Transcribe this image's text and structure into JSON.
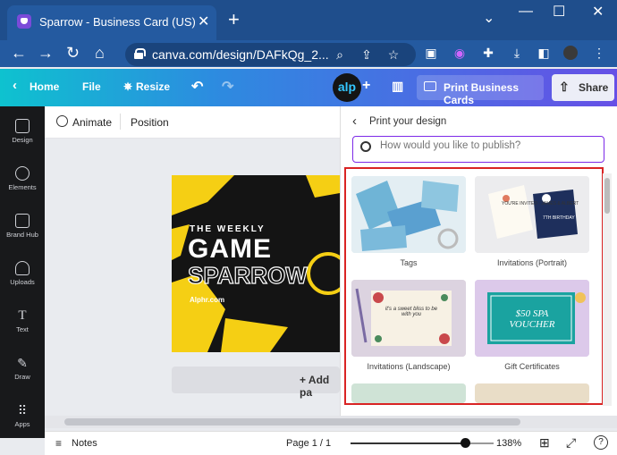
{
  "browser": {
    "tab_title": "Sparrow - Business Card (US)",
    "url": "canva.com/design/DAFkQg_2..."
  },
  "canva_header": {
    "home": "Home",
    "file": "File",
    "resize": "Resize",
    "avatar": "alp",
    "print": "Print Business Cards",
    "share": "Share"
  },
  "sidebar": {
    "items": [
      {
        "label": "Design"
      },
      {
        "label": "Elements"
      },
      {
        "label": "Brand Hub"
      },
      {
        "label": "Uploads"
      },
      {
        "label": "Text"
      },
      {
        "label": "Draw"
      },
      {
        "label": "Apps"
      }
    ]
  },
  "toolbar": {
    "animate": "Animate",
    "position": "Position"
  },
  "card": {
    "line1": "THE WEEKLY",
    "line2": "GAME",
    "line3": "SPARROW",
    "line4": "Alphr.com"
  },
  "add_page": "+ Add pa",
  "panel": {
    "title": "Print your design",
    "search_placeholder": "How would you like to publish?",
    "items": [
      {
        "label": "Tags"
      },
      {
        "label": "Invitations (Portrait)"
      },
      {
        "label": "Invitations (Landscape)"
      },
      {
        "label": "Gift Certificates"
      }
    ],
    "thumb_text": {
      "inv_portrait_1": "YOU'RE INVITED · JAMES & ALBERT",
      "inv_portrait_2": "7TH BIRTHDAY",
      "inv_landscape": "it's a sweet bliss to be with you",
      "gift": "$50 SPA VOUCHER"
    }
  },
  "footer": {
    "notes": "Notes",
    "page": "Page 1 / 1",
    "zoom": "138%",
    "zoom_level": 0.8,
    "help": "?"
  },
  "colors": {
    "canva_gradient_start": "#0ec2cf",
    "canva_gradient_end": "#6650e6",
    "highlight_red": "#d92424",
    "search_border": "#7d2ae8"
  }
}
